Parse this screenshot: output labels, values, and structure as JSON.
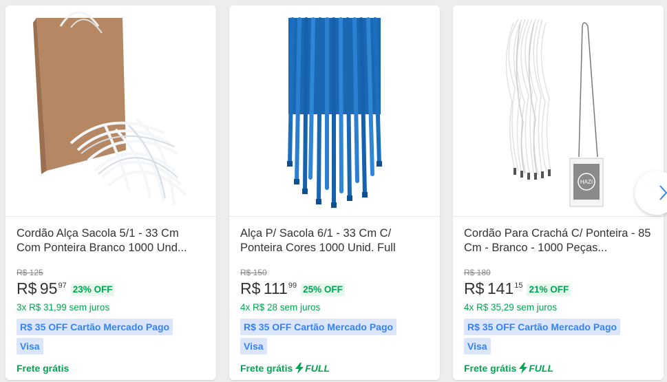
{
  "cards": [
    {
      "title": "Cordão Alça Sacola 5/1 - 33 Cm Com Ponteira Branco 1000 Und...",
      "old_price": "R$ 125",
      "currency": "R$",
      "price_int": "95",
      "price_cents": "97",
      "discount": "23% OFF",
      "installments": "3x R$ 31,99 sem juros",
      "promo_line1": "R$ 35 OFF Cartão Mercado Pago",
      "promo_line2": "Visa",
      "shipping": "Frete grátis",
      "full": ""
    },
    {
      "title": "Alça P/ Sacola 6/1 - 33 Cm C/ Ponteira Cores 1000 Unid. Full",
      "old_price": "R$ 150",
      "currency": "R$",
      "price_int": "111",
      "price_cents": "99",
      "discount": "25% OFF",
      "installments": "4x R$ 28 sem juros",
      "promo_line1": "R$ 35 OFF Cartão Mercado Pago",
      "promo_line2": "Visa",
      "shipping": "Frete grátis",
      "full": "FULL"
    },
    {
      "title": "Cordão Para Crachá C/ Ponteira - 85 Cm - Branco - 1000 Peças...",
      "old_price": "R$ 180",
      "currency": "R$",
      "price_int": "141",
      "price_cents": "15",
      "discount": "21% OFF",
      "installments": "4x R$ 35,29 sem juros",
      "promo_line1": "R$ 35 OFF Cartão Mercado Pago",
      "promo_line2": "Visa",
      "shipping": "Frete grátis",
      "full": "FULL",
      "badge_text": "HAZI"
    }
  ],
  "colors": {
    "green": "#00a650",
    "blue": "#3483fa",
    "promo_bg": "#dbe6fb"
  }
}
